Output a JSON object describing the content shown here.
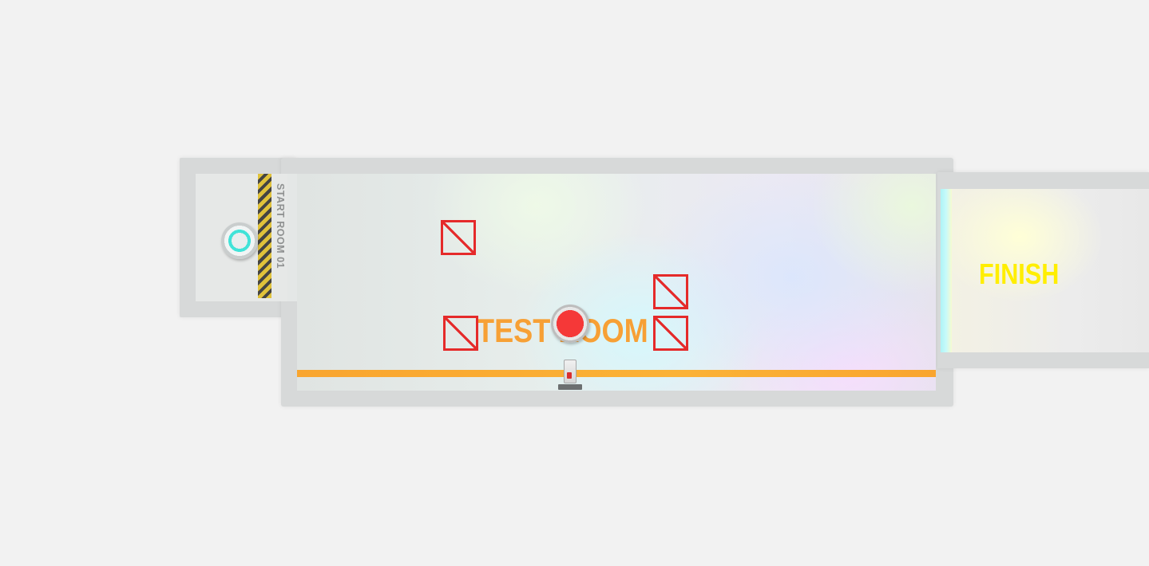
{
  "level": {
    "start_room_sign": "START ROOM 01",
    "main_room_label": "TEST ROOM",
    "finish_label": "FINISH"
  },
  "colors": {
    "wall": "#d7d9d9",
    "accent_line": "#f9a52f",
    "crate": "#e52a2a",
    "button": "#f53838",
    "finish_text": "#ffee00",
    "spawn_ring": "#41e3d8"
  },
  "objects": {
    "spawn_pad": "spawn-pad-icon",
    "crates": [
      "crate-icon",
      "crate-icon",
      "crate-icon",
      "crate-icon"
    ],
    "floor_button": "red-button-icon",
    "turret": "turret-icon"
  }
}
